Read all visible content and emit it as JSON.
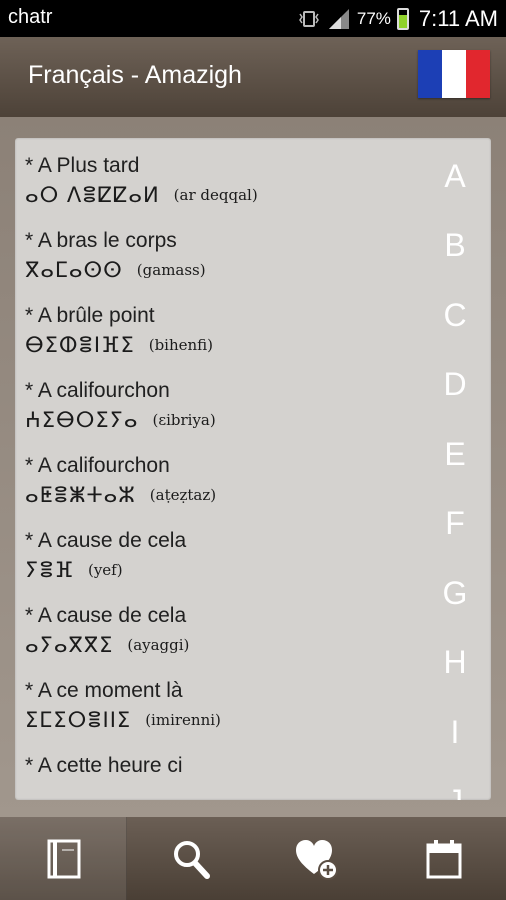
{
  "status_bar": {
    "carrier": "chatr",
    "battery_pct": "77%",
    "time": "7:11 AM",
    "icons": [
      "vibrate-icon",
      "signal-icon",
      "battery-icon"
    ]
  },
  "header": {
    "title": "Français - Amazigh",
    "flag": {
      "name": "french-flag-icon",
      "colors": [
        "#1c3fb5",
        "#ffffff",
        "#e1272e"
      ]
    }
  },
  "entries": [
    {
      "fr": "* A Plus tard",
      "tifinagh": "ⴰⵔ ⴷⴻⵇⵇⴰⵍ",
      "translit": "(ar deqqal)"
    },
    {
      "fr": "* A bras le corps",
      "tifinagh": "ⴳⴰⵎⴰⵙⵙ",
      "translit": "(gamass)"
    },
    {
      "fr": "* A brûle point",
      "tifinagh": "ⴱⵉⵀⴻⵏⴼⵉ",
      "translit": "(bihenfi)"
    },
    {
      "fr": "* A califourchon",
      "tifinagh": "ⵄⵉⴱⵔⵉⵢⴰ",
      "translit": "(ɛibriya)"
    },
    {
      "fr": "* A califourchon",
      "tifinagh": "ⴰⵟⴻⵥⵜⴰⵣ",
      "translit": "(aṭeẓtaz)"
    },
    {
      "fr": "* A cause  de cela",
      "tifinagh": "ⵢⴻⴼ",
      "translit": "(yef)"
    },
    {
      "fr": "* A cause  de cela",
      "tifinagh": "ⴰⵢⴰⴳⴳⵉ",
      "translit": "(ayaggi)"
    },
    {
      "fr": "* A ce moment là",
      "tifinagh": "ⵉⵎⵉⵔⴻⵏⵏⵉ",
      "translit": "(imirenni)"
    },
    {
      "fr": "* A cette heure ci",
      "tifinagh": "",
      "translit": ""
    }
  ],
  "alphabet_index": [
    "A",
    "B",
    "C",
    "D",
    "E",
    "F",
    "G",
    "H",
    "I",
    "J"
  ],
  "bottom_nav": [
    {
      "name": "dictionary-tab",
      "icon": "book-icon",
      "active": true
    },
    {
      "name": "search-tab",
      "icon": "search-icon",
      "active": false
    },
    {
      "name": "favorites-tab",
      "icon": "heart-add-icon",
      "active": false
    },
    {
      "name": "calendar-tab",
      "icon": "calendar-icon",
      "active": false
    }
  ]
}
